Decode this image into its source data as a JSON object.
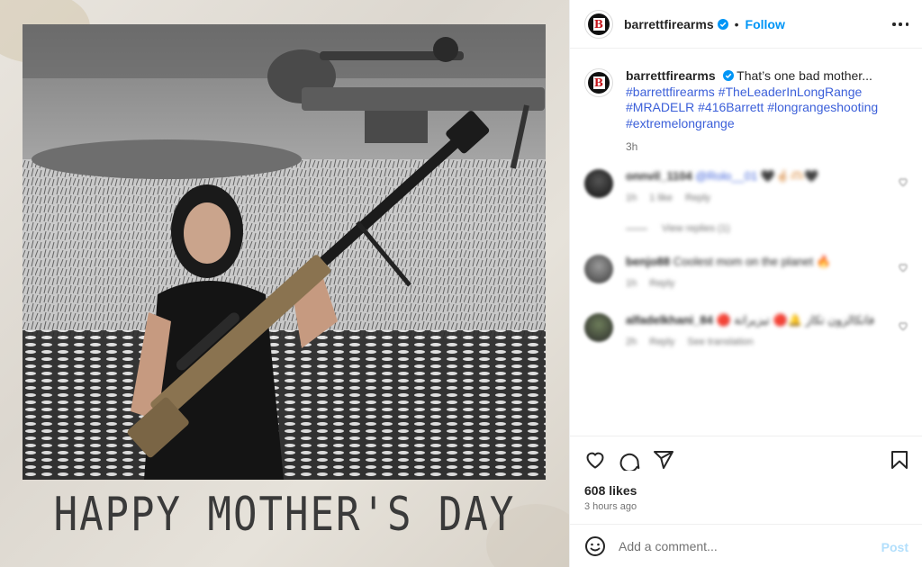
{
  "post": {
    "account": "barrettfirearms",
    "follow_label": "Follow",
    "separator": "•",
    "caption_text": "That’s one bad mother...",
    "hashtags": [
      "#barrettfirearms",
      "#TheLeaderInLongRange",
      "#MRADELR",
      "#416Barrett",
      "#longrangeshooting",
      "#extremelongrange"
    ],
    "posted_ago": "3h",
    "image_caption": "HAPPY MOTHER'S DAY",
    "likes": "608 likes",
    "timestamp": "3 hours ago",
    "brand_letter": "B"
  },
  "comments": [
    {
      "user": "onnvil_1104",
      "text": "@Rolo__01 🖤🤞🏻🫶🏻🖤",
      "age": "1h",
      "likes": "1 like",
      "reply": "Reply"
    },
    {
      "user": "benjo88",
      "text": "Coolest mom on the planet 🔥",
      "age": "1h",
      "reply": "Reply"
    },
    {
      "user": "alfadelkhani_84",
      "text": "🔴 فاتكالزون تكاز 🔔🔴 تيزيراتة",
      "age": "2h",
      "reply": "Reply",
      "translate": "See translation"
    }
  ],
  "view_replies": "View replies (1)",
  "add_comment": {
    "placeholder": "Add a comment...",
    "post_label": "Post"
  },
  "colors": {
    "accent": "#0095f6",
    "hashtag": "#3b5fd9",
    "muted": "#737373",
    "rifle_tan": "#8a7350"
  },
  "icons": [
    "verified-badge-icon",
    "more-options-icon",
    "heart-icon",
    "comment-icon",
    "share-icon",
    "bookmark-icon",
    "emoji-icon"
  ]
}
